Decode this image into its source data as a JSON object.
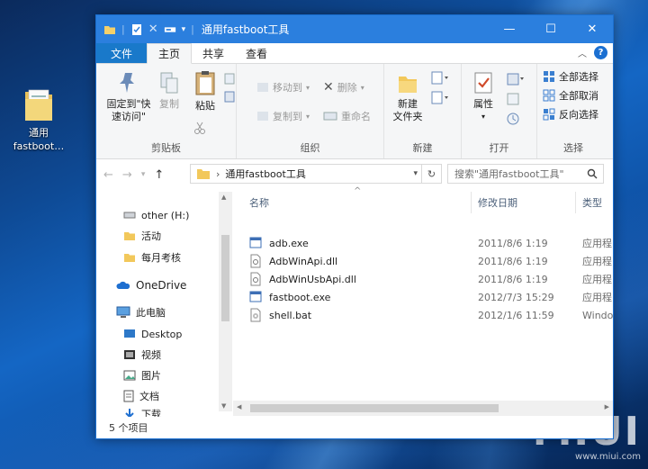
{
  "desktop": {
    "icon_label_line1": "通用",
    "icon_label_line2": "fastboot…"
  },
  "watermark": {
    "logo": "MIUI",
    "url": "www.miui.com"
  },
  "window": {
    "title": "通用fastboot工具",
    "controls": {
      "minimize": "—",
      "maximize": "☐",
      "close": "✕"
    }
  },
  "tabs": [
    {
      "label": "文件"
    },
    {
      "label": "主页"
    },
    {
      "label": "共享"
    },
    {
      "label": "查看"
    }
  ],
  "ribbon": {
    "clipboard": {
      "pin_label_1": "固定到\"快",
      "pin_label_2": "速访问\"",
      "copy_label": "复制",
      "paste_label": "粘贴",
      "group_name": "剪贴板"
    },
    "organize": {
      "move_to": "移动到",
      "copy_to": "复制到",
      "delete": "删除",
      "rename": "重命名",
      "group_name": "组织"
    },
    "new": {
      "new_folder_1": "新建",
      "new_folder_2": "文件夹",
      "group_name": "新建"
    },
    "open": {
      "properties": "属性",
      "group_name": "打开"
    },
    "select": {
      "select_all": "全部选择",
      "select_none": "全部取消",
      "invert": "反向选择",
      "group_name": "选择"
    }
  },
  "address": {
    "path": "通用fastboot工具",
    "search_placeholder": "搜索\"通用fastboot工具\""
  },
  "nav": {
    "items": [
      {
        "label": "other (H:)",
        "icon": "drive-icon"
      },
      {
        "label": "活动",
        "icon": "folder-icon"
      },
      {
        "label": "每月考核",
        "icon": "folder-icon"
      },
      {
        "label": "OneDrive",
        "icon": "cloud-icon"
      },
      {
        "label": "此电脑",
        "icon": "computer-icon"
      },
      {
        "label": "Desktop",
        "icon": "desktop-icon"
      },
      {
        "label": "视频",
        "icon": "video-icon"
      },
      {
        "label": "图片",
        "icon": "picture-icon"
      },
      {
        "label": "文档",
        "icon": "document-icon"
      },
      {
        "label": "下载",
        "icon": "download-icon"
      }
    ]
  },
  "columns": {
    "name": "名称",
    "date": "修改日期",
    "type": "类型"
  },
  "files": [
    {
      "name": "adb.exe",
      "date": "2011/8/6 1:19",
      "type": "应用程",
      "icon": "exe-icon"
    },
    {
      "name": "AdbWinApi.dll",
      "date": "2011/8/6 1:19",
      "type": "应用程",
      "icon": "dll-icon"
    },
    {
      "name": "AdbWinUsbApi.dll",
      "date": "2011/8/6 1:19",
      "type": "应用程",
      "icon": "dll-icon"
    },
    {
      "name": "fastboot.exe",
      "date": "2012/7/3 15:29",
      "type": "应用程",
      "icon": "exe-icon"
    },
    {
      "name": "shell.bat",
      "date": "2012/1/6 11:59",
      "type": "Windo",
      "icon": "bat-icon"
    }
  ],
  "status": {
    "count": "5 个项目"
  }
}
